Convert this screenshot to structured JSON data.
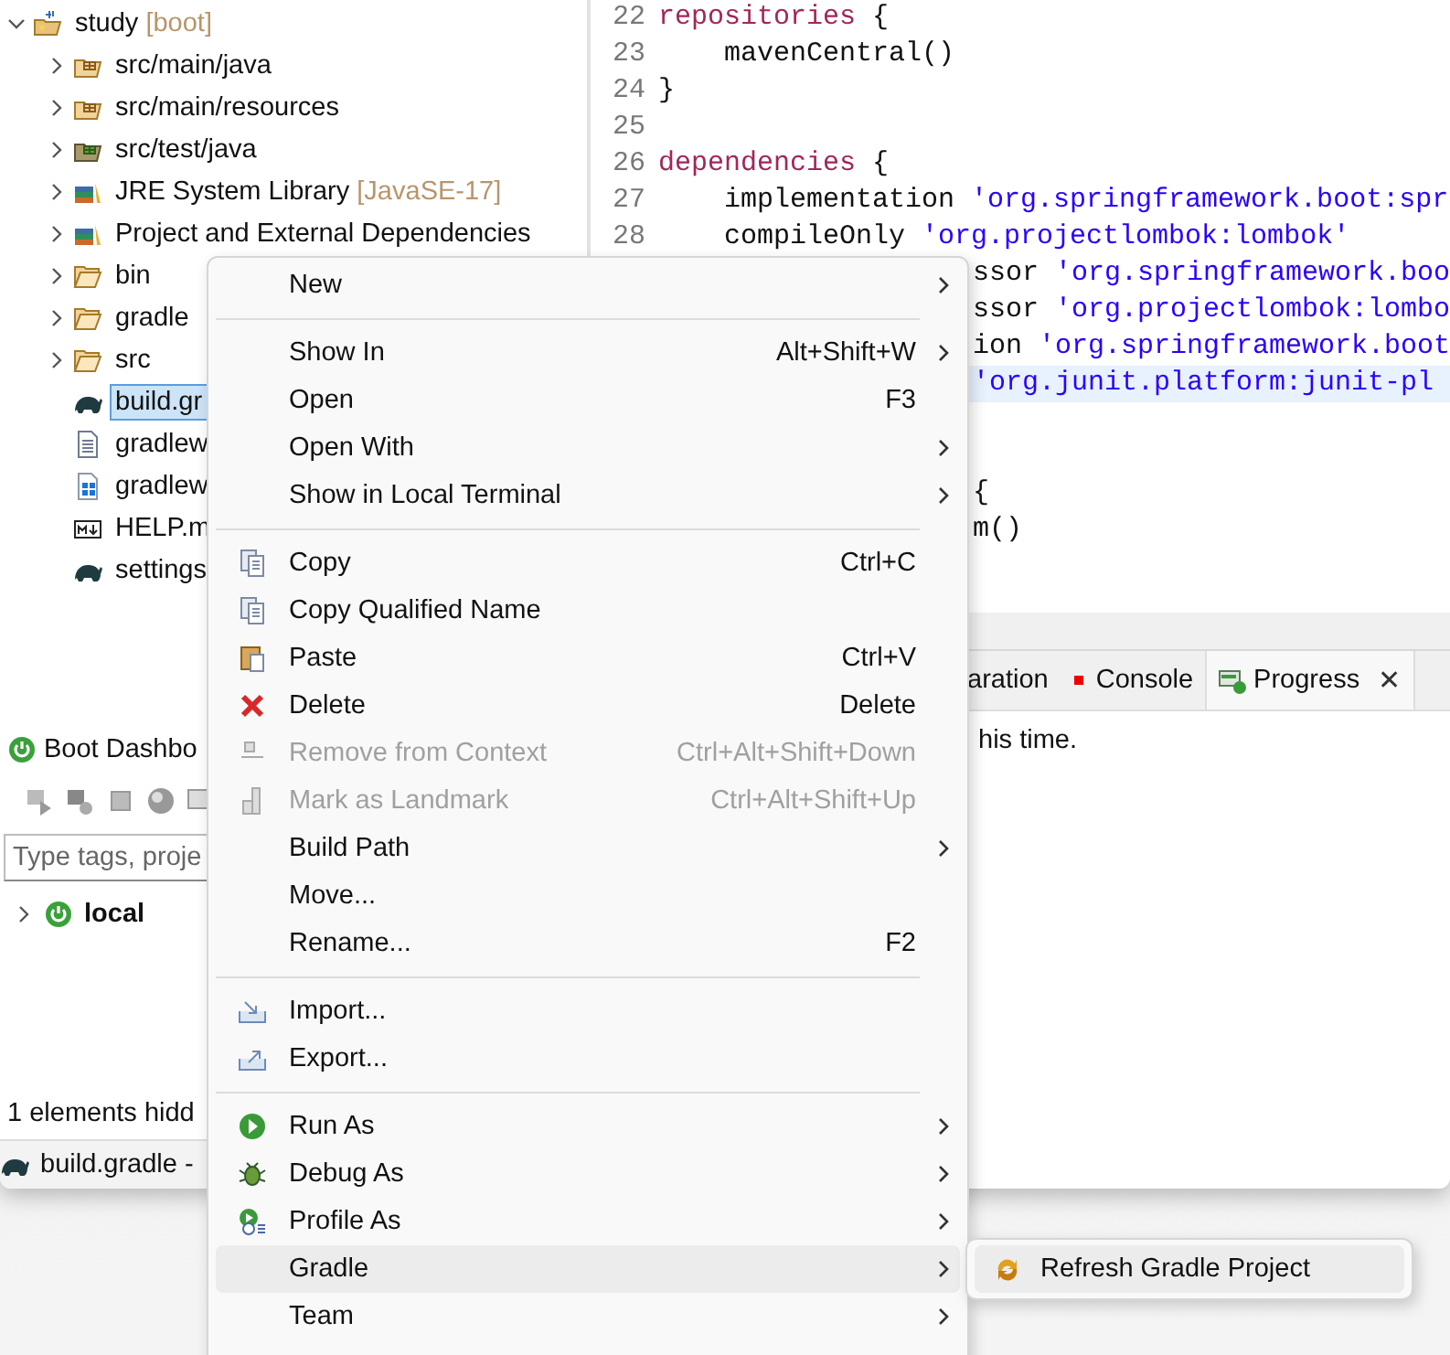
{
  "project_explorer": {
    "root": {
      "label": "study",
      "decoration": "[boot]",
      "kind": "project",
      "expanded": true,
      "children": [
        {
          "label": "src/main/java",
          "kind": "package-folder",
          "expanded": false,
          "selected": false
        },
        {
          "label": "src/main/resources",
          "kind": "package-folder",
          "expanded": false,
          "selected": false
        },
        {
          "label": "src/test/java",
          "kind": "test-folder",
          "expanded": false,
          "selected": false
        },
        {
          "label": "JRE System Library",
          "decoration": "[JavaSE-17]",
          "kind": "library",
          "expanded": false,
          "selected": false
        },
        {
          "label": "Project and External Dependencies",
          "kind": "library",
          "expanded": false,
          "selected": false
        },
        {
          "label": "bin",
          "kind": "folder",
          "expanded": false,
          "selected": false
        },
        {
          "label": "gradle",
          "kind": "folder",
          "expanded": false,
          "selected": false
        },
        {
          "label": "src",
          "kind": "folder",
          "expanded": false,
          "selected": false
        },
        {
          "label": "build.gr",
          "kind": "gradle",
          "selected": true
        },
        {
          "label": "gradlew",
          "kind": "text-file",
          "selected": false
        },
        {
          "label": "gradlew",
          "kind": "windows-file",
          "selected": false
        },
        {
          "label": "HELP.m",
          "kind": "markdown-file",
          "selected": false
        },
        {
          "label": "settings",
          "kind": "gradle",
          "selected": false
        }
      ]
    }
  },
  "editor": {
    "lines": [
      {
        "kind": "code",
        "number": "22",
        "tokens": [
          {
            "kind": "keyword",
            "text": "repositories"
          },
          {
            "kind": "plain",
            "text": " {"
          }
        ]
      },
      {
        "kind": "indented",
        "number": "23",
        "tokens": [
          {
            "kind": "plain",
            "text": "mavenCentral()"
          }
        ]
      },
      {
        "kind": "code",
        "number": "24",
        "tokens": [
          {
            "kind": "plain",
            "text": "}"
          }
        ]
      },
      {
        "kind": "code",
        "number": "25"
      },
      {
        "kind": "code",
        "number": "26",
        "tokens": [
          {
            "kind": "keyword",
            "text": "dependencies"
          },
          {
            "kind": "plain",
            "text": " {"
          }
        ]
      },
      {
        "kind": "indented",
        "number": "27",
        "tokens": [
          {
            "kind": "plain",
            "text": "implementation "
          },
          {
            "kind": "string",
            "text": "'org.springframework.boot:spr"
          }
        ]
      },
      {
        "kind": "indented",
        "number": "28",
        "tokens": [
          {
            "kind": "plain",
            "text": "compileOnly "
          },
          {
            "kind": "string",
            "text": "'org.projectlombok:lombok'"
          }
        ]
      },
      {
        "kind": "covered",
        "tokens": [
          {
            "kind": "plain",
            "text": "ssor "
          },
          {
            "kind": "string",
            "text": "'org.springframework.boo"
          }
        ]
      },
      {
        "kind": "covered",
        "tokens": [
          {
            "kind": "plain",
            "text": "ssor "
          },
          {
            "kind": "string",
            "text": "'org.projectlombok:lombo"
          }
        ]
      },
      {
        "kind": "covered",
        "tokens": [
          {
            "kind": "plain",
            "text": "ion "
          },
          {
            "kind": "string",
            "text": "'org.springframework.boot"
          }
        ]
      },
      {
        "kind": "covered",
        "highlighted": true,
        "tokens": [
          {
            "kind": "string",
            "text": "'org.junit.platform:junit-pl"
          }
        ]
      },
      {
        "kind": "blank"
      },
      {
        "kind": "blank"
      },
      {
        "kind": "covered",
        "tokens": [
          {
            "kind": "plain",
            "text": "{"
          }
        ]
      },
      {
        "kind": "covered",
        "tokens": [
          {
            "kind": "plain",
            "text": "m()"
          }
        ]
      }
    ]
  },
  "bottom_panel": {
    "tabs": [
      {
        "label": "aration",
        "kind": "plain",
        "selected": false
      },
      {
        "label": "Console",
        "kind": "console",
        "selected": false
      },
      {
        "label": "Progress",
        "kind": "progress",
        "selected": true,
        "close": "✕"
      }
    ],
    "message": "his time."
  },
  "boot_dashboard": {
    "title": "Boot Dashbo",
    "filter": {
      "placeholder": "Type tags, proje"
    },
    "items": [
      {
        "label": "local",
        "expanded": false
      }
    ],
    "hidden_note": "1 elements hidd"
  },
  "status_bar": {
    "text": "build.gradle -"
  },
  "context_menu": {
    "groups": [
      [
        {
          "label": "New",
          "kind": "plain",
          "submenu": true,
          "disabled": false,
          "selected": false
        }
      ],
      [
        {
          "label": "Show In",
          "kind": "plain",
          "shortcut": "Alt+Shift+W",
          "submenu": true,
          "disabled": false,
          "selected": false
        },
        {
          "label": "Open",
          "kind": "plain",
          "shortcut": "F3",
          "submenu": false,
          "disabled": false,
          "selected": false
        },
        {
          "label": "Open With",
          "kind": "plain",
          "submenu": true,
          "disabled": false,
          "selected": false
        },
        {
          "label": "Show in Local Terminal",
          "kind": "plain",
          "submenu": true,
          "disabled": false,
          "selected": false
        }
      ],
      [
        {
          "label": "Copy",
          "kind": "copy",
          "shortcut": "Ctrl+C",
          "submenu": false,
          "disabled": false,
          "selected": false
        },
        {
          "label": "Copy Qualified Name",
          "kind": "copy",
          "submenu": false,
          "disabled": false,
          "selected": false
        },
        {
          "label": "Paste",
          "kind": "paste",
          "shortcut": "Ctrl+V",
          "submenu": false,
          "disabled": false,
          "selected": false
        },
        {
          "label": "Delete",
          "kind": "delete",
          "shortcut": "Delete",
          "submenu": false,
          "disabled": false,
          "selected": false
        },
        {
          "label": "Remove from Context",
          "kind": "remove",
          "shortcut": "Ctrl+Alt+Shift+Down",
          "submenu": false,
          "disabled": true,
          "selected": false
        },
        {
          "label": "Mark as Landmark",
          "kind": "landmark",
          "shortcut": "Ctrl+Alt+Shift+Up",
          "submenu": false,
          "disabled": true,
          "selected": false
        },
        {
          "label": "Build Path",
          "kind": "plain",
          "submenu": true,
          "disabled": false,
          "selected": false
        },
        {
          "label": "Move...",
          "kind": "plain",
          "submenu": false,
          "disabled": false,
          "selected": false
        },
        {
          "label": "Rename...",
          "kind": "plain",
          "shortcut": "F2",
          "submenu": false,
          "disabled": false,
          "selected": false
        }
      ],
      [
        {
          "label": "Import...",
          "kind": "import",
          "submenu": false,
          "disabled": false,
          "selected": false
        },
        {
          "label": "Export...",
          "kind": "export",
          "submenu": false,
          "disabled": false,
          "selected": false
        }
      ],
      [
        {
          "label": "Run As",
          "kind": "run",
          "submenu": true,
          "disabled": false,
          "selected": false
        },
        {
          "label": "Debug As",
          "kind": "debug",
          "submenu": true,
          "disabled": false,
          "selected": false
        },
        {
          "label": "Profile As",
          "kind": "profile",
          "submenu": true,
          "disabled": false,
          "selected": false
        },
        {
          "label": "Gradle",
          "kind": "plain",
          "submenu": true,
          "disabled": false,
          "selected": true
        },
        {
          "label": "Team",
          "kind": "plain",
          "submenu": true,
          "disabled": false,
          "selected": false
        }
      ]
    ]
  },
  "submenu": {
    "items": [
      {
        "label": "Refresh Gradle Project",
        "kind": "refresh",
        "selected": true
      }
    ]
  }
}
